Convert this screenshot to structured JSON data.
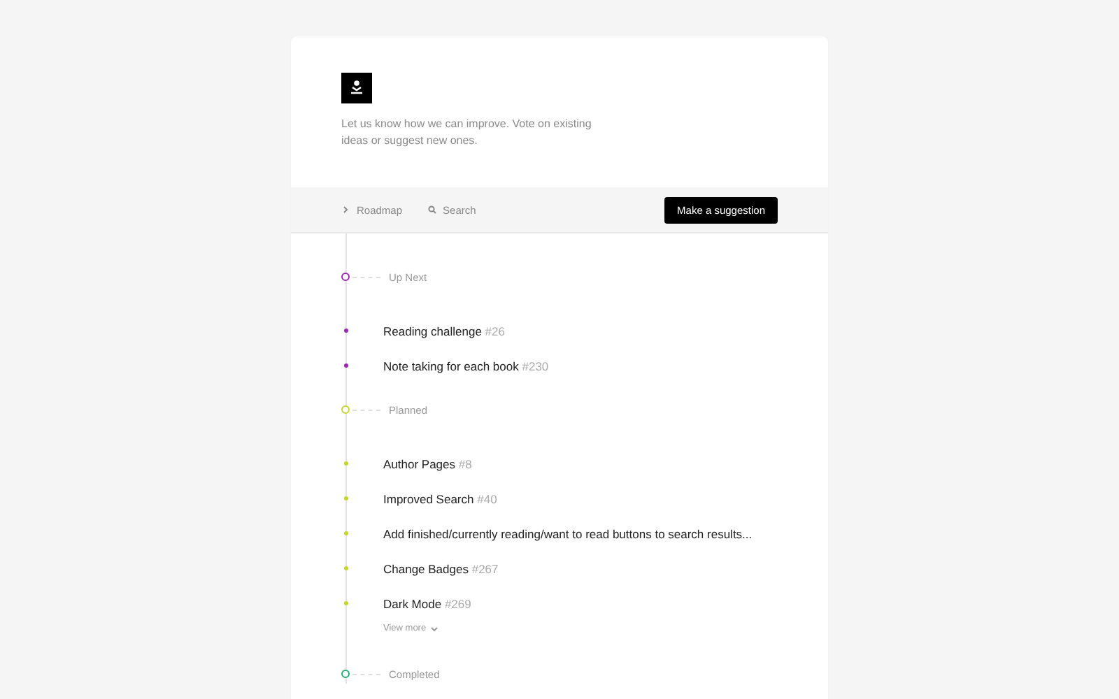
{
  "header": {
    "intro": "Let us know how we can improve. Vote on existing ideas or suggest new ones."
  },
  "nav": {
    "roadmap": "Roadmap",
    "search": "Search",
    "button": "Make a suggestion"
  },
  "groups": [
    {
      "title": "Up Next",
      "color": "#9c27b0",
      "items": [
        {
          "title": "Reading challenge",
          "number": "#26"
        },
        {
          "title": "Note taking for each book",
          "number": "#230"
        }
      ]
    },
    {
      "title": "Planned",
      "color": "#c6d62b",
      "items": [
        {
          "title": "Author Pages",
          "number": "#8"
        },
        {
          "title": "Improved Search",
          "number": "#40"
        },
        {
          "title": "Add finished/currently reading/want to read buttons to search results..."
        },
        {
          "title": "Change Badges",
          "number": "#267"
        },
        {
          "title": "Dark Mode",
          "number": "#269"
        }
      ],
      "view_more": "View more"
    },
    {
      "title": "Completed",
      "color": "#26b074"
    }
  ]
}
